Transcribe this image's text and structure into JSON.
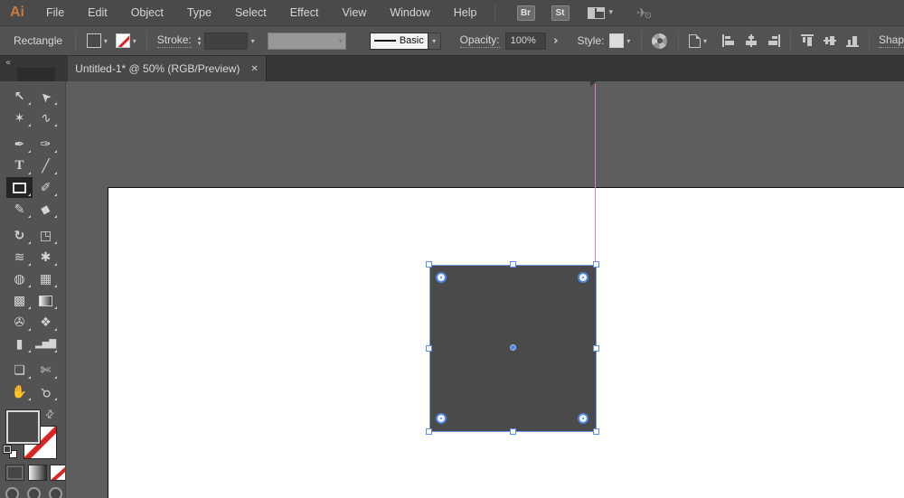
{
  "app": {
    "logo_text": "Ai",
    "menu_items": [
      "File",
      "Edit",
      "Object",
      "Type",
      "Select",
      "Effect",
      "View",
      "Window",
      "Help"
    ],
    "bridge_button": "Br",
    "stock_button": "St"
  },
  "control_bar": {
    "tool_name": "Rectangle",
    "stroke_label": "Stroke:",
    "brush_name": "Basic",
    "opacity_label": "Opacity:",
    "opacity_value": "100%",
    "opacity_expand_glyph": "›",
    "style_label": "Style:",
    "shape_label_truncated": "Shap"
  },
  "document_tab": {
    "collapse_glyph": "«",
    "title": "Untitled-1* @ 50% (RGB/Preview)",
    "close_glyph": "✕"
  },
  "tools": [
    {
      "name": "selection-tool",
      "glyph": "↖"
    },
    {
      "name": "direct-selection-tool",
      "glyph": "➤"
    },
    {
      "name": "magic-wand-tool",
      "glyph": "✶"
    },
    {
      "name": "lasso-tool",
      "glyph": "∿"
    },
    {
      "name": "pen-tool",
      "glyph": "✒"
    },
    {
      "name": "curvature-tool",
      "glyph": "✑"
    },
    {
      "name": "type-tool",
      "glyph": "T"
    },
    {
      "name": "line-segment-tool",
      "glyph": "╱"
    },
    {
      "name": "rectangle-tool",
      "glyph": ""
    },
    {
      "name": "paintbrush-tool",
      "glyph": "✐"
    },
    {
      "name": "shaper-tool",
      "glyph": "✎"
    },
    {
      "name": "eraser-tool",
      "glyph": "◆"
    },
    {
      "name": "rotate-tool",
      "glyph": "↻"
    },
    {
      "name": "scale-tool",
      "glyph": "◳"
    },
    {
      "name": "width-tool",
      "glyph": "≋"
    },
    {
      "name": "puppet-warp-tool",
      "glyph": "✱"
    },
    {
      "name": "shape-builder-tool",
      "glyph": "◍"
    },
    {
      "name": "perspective-grid-tool",
      "glyph": "▦"
    },
    {
      "name": "mesh-tool",
      "glyph": "▩"
    },
    {
      "name": "gradient-tool",
      "glyph": ""
    },
    {
      "name": "eyedropper-tool",
      "glyph": "✇"
    },
    {
      "name": "blend-tool",
      "glyph": "❖"
    },
    {
      "name": "symbol-sprayer-tool",
      "glyph": "▮"
    },
    {
      "name": "column-graph-tool",
      "glyph": "▂▅▇"
    },
    {
      "name": "artboard-tool",
      "glyph": "❏"
    },
    {
      "name": "slice-tool",
      "glyph": "✄"
    },
    {
      "name": "hand-tool",
      "glyph": "✋"
    },
    {
      "name": "zoom-tool",
      "glyph": "⚲"
    }
  ],
  "colors": {
    "selection_blue": "#4f86e0",
    "smart_guide_magenta": "#de74de",
    "shape_fill_gray": "#4a4a4a",
    "artboard_white": "#ffffff",
    "panel_gray": "#535353",
    "pasteboard_gray": "#5e5e5e",
    "logo_orange": "#c77b3f",
    "stroke_none_red": "#dd2222"
  }
}
